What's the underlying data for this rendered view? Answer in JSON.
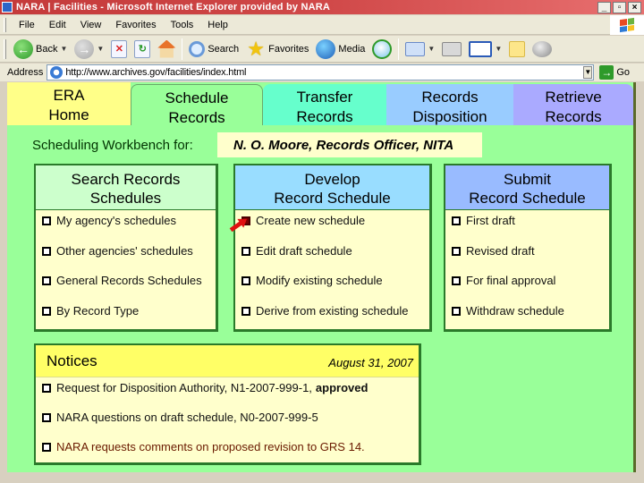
{
  "window": {
    "title": "NARA | Facilities - Microsoft Internet Explorer provided by NARA",
    "controls": [
      "_",
      "▫",
      "×"
    ]
  },
  "menu": [
    "File",
    "Edit",
    "View",
    "Favorites",
    "Tools",
    "Help"
  ],
  "toolbar": {
    "back": "Back",
    "search": "Search",
    "favorites": "Favorites",
    "media": "Media"
  },
  "address": {
    "label": "Address",
    "url": "http://www.archives.gov/facilities/index.html",
    "go": "Go"
  },
  "tabs": [
    {
      "line1": "ERA",
      "line2": "Home"
    },
    {
      "line1": "Schedule",
      "line2": "Records"
    },
    {
      "line1": "Transfer",
      "line2": "Records"
    },
    {
      "line1": "Records",
      "line2": "Disposition"
    },
    {
      "line1": "Retrieve",
      "line2": "Records"
    }
  ],
  "workbench": {
    "label": "Scheduling Workbench for:",
    "user": "N. O. Moore, Records Officer, NITA"
  },
  "panels": {
    "search": {
      "title1": "Search Records",
      "title2": "Schedules",
      "items": [
        "My agency's schedules",
        "Other agencies' schedules",
        "General Records Schedules",
        "By Record Type"
      ]
    },
    "develop": {
      "title1": "Develop",
      "title2": "Record Schedule",
      "items": [
        "Create new schedule",
        "Edit draft schedule",
        "Modify existing schedule",
        "Derive from existing schedule"
      ]
    },
    "submit": {
      "title1": "Submit",
      "title2": "Record Schedule",
      "items": [
        "First draft",
        "Revised draft",
        "For final approval",
        "Withdraw schedule"
      ]
    }
  },
  "notices": {
    "title": "Notices",
    "date": "August 31, 2007",
    "items": [
      {
        "text": "Request for Disposition Authority, N1-2007-999-1,",
        "status": "approved"
      },
      {
        "text": "NARA questions on draft schedule, N0-2007-999-5"
      },
      {
        "text": "NARA requests comments on proposed revision to GRS 14."
      }
    ]
  }
}
